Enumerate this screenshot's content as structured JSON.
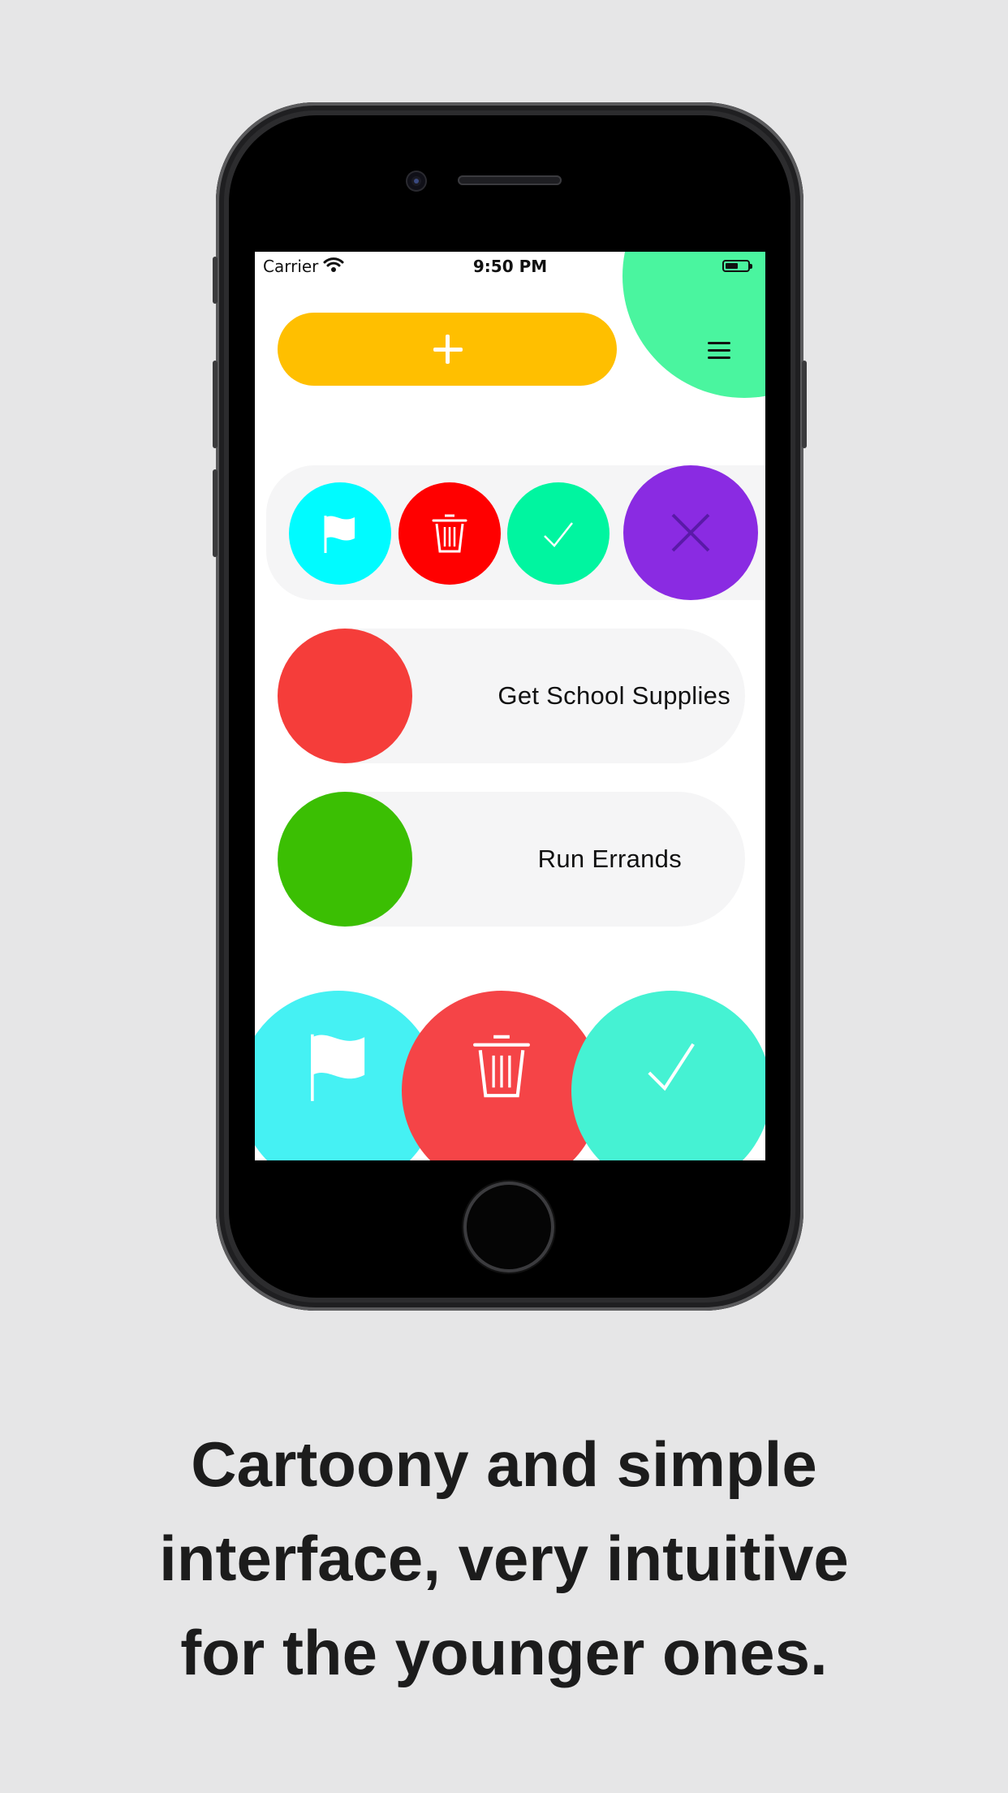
{
  "status_bar": {
    "carrier": "Carrier",
    "time": "9:50 PM"
  },
  "icons": {
    "add": "plus-icon",
    "menu": "hamburger-menu-icon",
    "flag": "flag-icon",
    "trash": "trash-icon",
    "check": "checkmark-icon",
    "close": "close-icon"
  },
  "colors": {
    "background": "#e6e6e7",
    "add_button": "#ffbf00",
    "menu_blob": "#4af59f",
    "swipe_flag": "#00fbff",
    "swipe_trash": "#ff0000",
    "swipe_check": "#00f5a0",
    "swipe_close": "#8a2be2",
    "bottom_flag": "#45f1f3",
    "bottom_trash": "#f54447",
    "bottom_check": "#45f2d3"
  },
  "tasks": [
    {
      "label": "Get School Supplies",
      "color": "#f53d3a"
    },
    {
      "label": "Run Errands",
      "color": "#3bbf03"
    }
  ],
  "caption": {
    "line1": "Cartoony and simple",
    "line2": "interface, very intuitive",
    "line3": "for the younger ones."
  }
}
